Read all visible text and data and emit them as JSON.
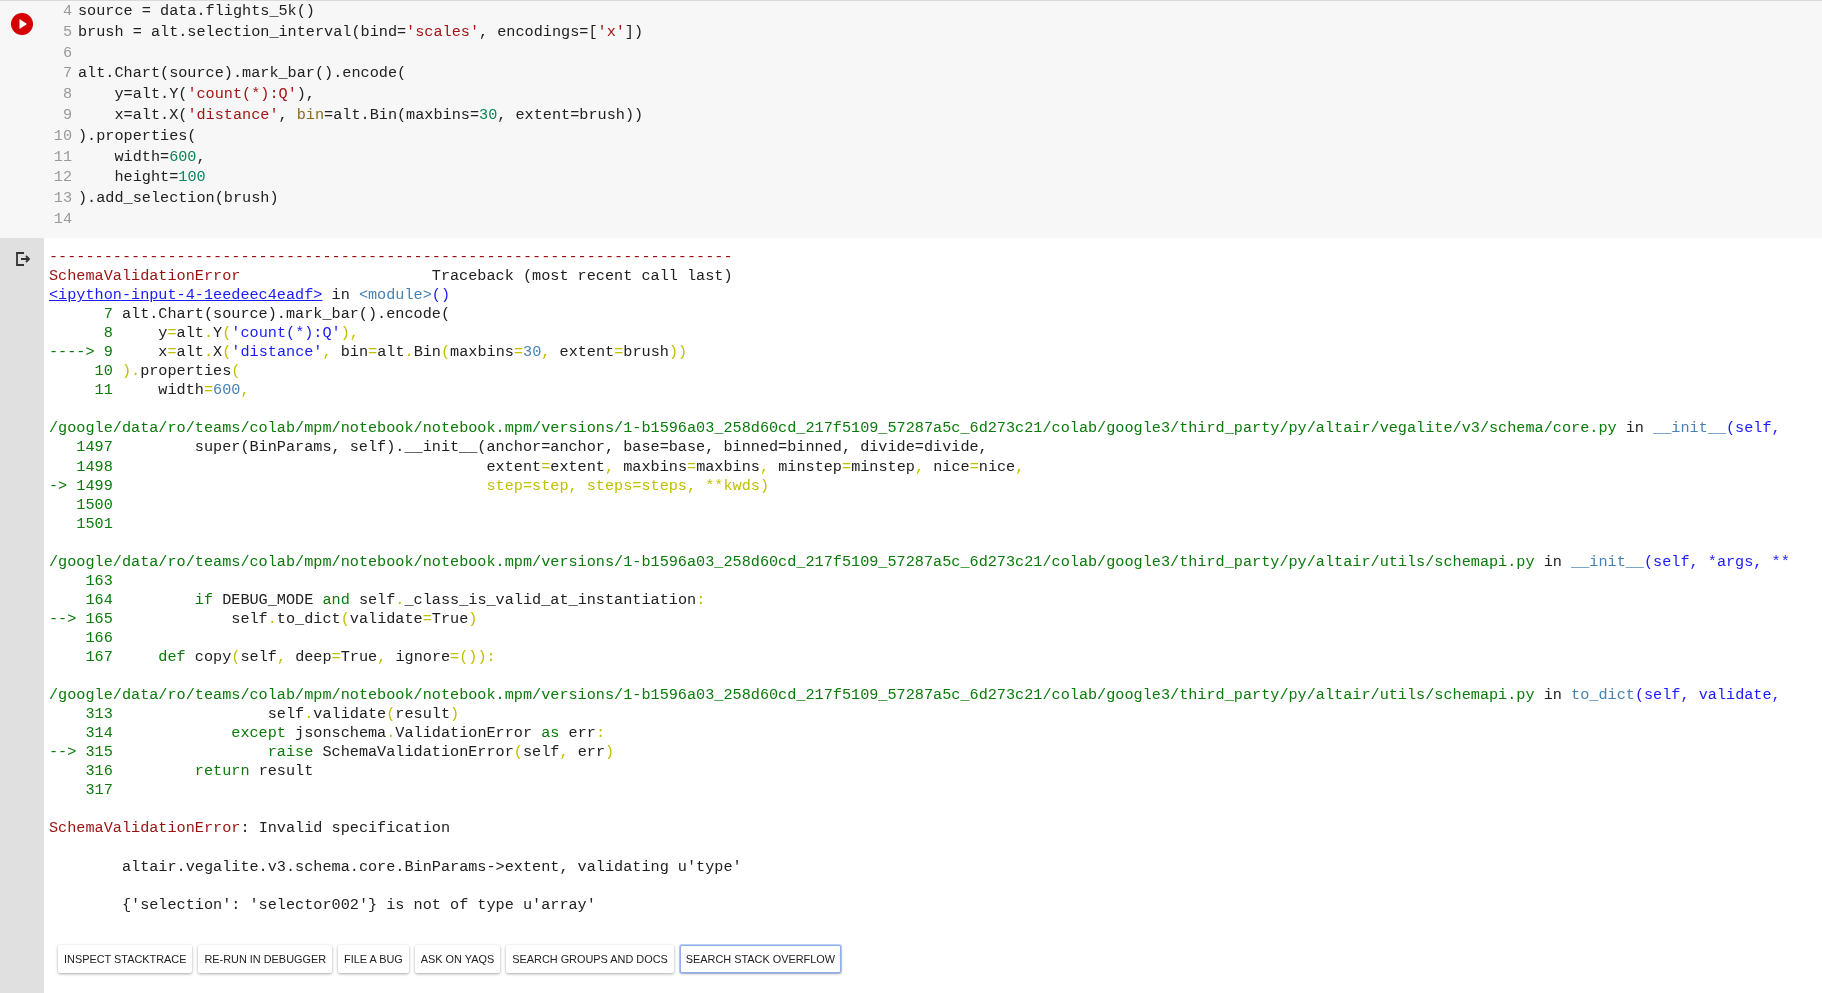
{
  "code_cell": {
    "lines": [
      {
        "number": "4",
        "tokens": [
          {
            "text": "source = data.flights_5k()",
            "kind": "plain"
          }
        ]
      },
      {
        "number": "5",
        "tokens": [
          {
            "text": "brush = alt.selection_interval(bind=",
            "kind": "plain"
          },
          {
            "text": "'scales'",
            "kind": "string"
          },
          {
            "text": ", encodings=[",
            "kind": "plain"
          },
          {
            "text": "'x'",
            "kind": "string"
          },
          {
            "text": "])",
            "kind": "plain"
          }
        ]
      },
      {
        "number": "6"
      },
      {
        "number": "7",
        "tokens": [
          {
            "text": "alt.Chart(source).mark_bar().encode(",
            "kind": "plain"
          }
        ]
      },
      {
        "number": "8",
        "tokens": [
          {
            "text": "    y=alt.Y(",
            "kind": "plain"
          },
          {
            "text": "'count(*):Q'",
            "kind": "string"
          },
          {
            "text": "),",
            "kind": "plain"
          }
        ]
      },
      {
        "number": "9",
        "tokens": [
          {
            "text": "    x=alt.X(",
            "kind": "plain"
          },
          {
            "text": "'distance'",
            "kind": "string"
          },
          {
            "text": ", ",
            "kind": "plain"
          },
          {
            "text": "bin",
            "kind": "param"
          },
          {
            "text": "=alt.Bin(maxbins=",
            "kind": "plain"
          },
          {
            "text": "30",
            "kind": "number"
          },
          {
            "text": ", extent=brush))",
            "kind": "plain"
          }
        ]
      },
      {
        "number": "10",
        "tokens": [
          {
            "text": ").properties(",
            "kind": "plain"
          }
        ]
      },
      {
        "number": "11",
        "tokens": [
          {
            "text": "    width=",
            "kind": "plain"
          },
          {
            "text": "600",
            "kind": "number"
          },
          {
            "text": ",",
            "kind": "plain"
          }
        ]
      },
      {
        "number": "12",
        "tokens": [
          {
            "text": "    height=",
            "kind": "plain"
          },
          {
            "text": "100",
            "kind": "number"
          }
        ]
      },
      {
        "number": "13",
        "tokens": [
          {
            "text": ").add_selection(brush)",
            "kind": "plain"
          }
        ]
      },
      {
        "number": "14"
      }
    ]
  },
  "output": {
    "separator": "---------------------------------------------------------------------------",
    "error_name": "SchemaValidationError",
    "traceback_label": "Traceback (most recent call last)",
    "frames": [
      {
        "location": [
          {
            "text": "<ipython-input-4-1eedeec4eadf>",
            "kind": "link"
          },
          {
            "text": " in ",
            "kind": "plain"
          },
          {
            "text": "<module>",
            "kind": "name"
          },
          {
            "text": "()",
            "kind": "call"
          }
        ],
        "lines": [
          {
            "number": "7",
            "tokens": [
              {
                "text": "alt.Chart(source).mark_bar().encode(",
                "kind": "plain"
              }
            ]
          },
          {
            "number": "8",
            "tokens": [
              {
                "text": "    y",
                "kind": "plain"
              },
              {
                "text": "=",
                "kind": "punct"
              },
              {
                "text": "alt",
                "kind": "plain"
              },
              {
                "text": ".",
                "kind": "punct"
              },
              {
                "text": "Y",
                "kind": "plain"
              },
              {
                "text": "(",
                "kind": "punct"
              },
              {
                "text": "'count(*):Q'",
                "kind": "string"
              },
              {
                "text": "),",
                "kind": "punct"
              }
            ]
          },
          {
            "marker": "---->",
            "number": "9",
            "tokens": [
              {
                "text": "    x",
                "kind": "plain"
              },
              {
                "text": "=",
                "kind": "punct"
              },
              {
                "text": "alt",
                "kind": "plain"
              },
              {
                "text": ".",
                "kind": "punct"
              },
              {
                "text": "X",
                "kind": "plain"
              },
              {
                "text": "(",
                "kind": "punct"
              },
              {
                "text": "'distance'",
                "kind": "string"
              },
              {
                "text": ", ",
                "kind": "punct"
              },
              {
                "text": "bin",
                "kind": "plain"
              },
              {
                "text": "=",
                "kind": "punct"
              },
              {
                "text": "alt",
                "kind": "plain"
              },
              {
                "text": ".",
                "kind": "punct"
              },
              {
                "text": "Bin",
                "kind": "plain"
              },
              {
                "text": "(",
                "kind": "punct"
              },
              {
                "text": "maxbins",
                "kind": "plain"
              },
              {
                "text": "=",
                "kind": "punct"
              },
              {
                "text": "30",
                "kind": "number"
              },
              {
                "text": ", ",
                "kind": "punct"
              },
              {
                "text": "extent",
                "kind": "plain"
              },
              {
                "text": "=",
                "kind": "punct"
              },
              {
                "text": "brush",
                "kind": "plain"
              },
              {
                "text": "))",
                "kind": "punct"
              }
            ]
          },
          {
            "number": "10",
            "tokens": [
              {
                "text": ").",
                "kind": "punct"
              },
              {
                "text": "properties",
                "kind": "plain"
              },
              {
                "text": "(",
                "kind": "punct"
              }
            ]
          },
          {
            "number": "11",
            "tokens": [
              {
                "text": "    width",
                "kind": "plain"
              },
              {
                "text": "=",
                "kind": "punct"
              },
              {
                "text": "600",
                "kind": "number"
              },
              {
                "text": ",",
                "kind": "punct"
              }
            ]
          }
        ]
      },
      {
        "location": [
          {
            "text": "/google/data/ro/teams/colab/mpm/notebook/notebook.mpm/versions/1-b1596a03_258d60cd_217f5109_57287a5c_6d273c21/colab/google3/third_party/py/altair/vegalite/v3/schema/core.py",
            "kind": "path"
          },
          {
            "text": " in ",
            "kind": "plain"
          },
          {
            "text": "__init__",
            "kind": "name"
          },
          {
            "text": "(self,",
            "kind": "call"
          }
        ],
        "lines": [
          {
            "number": "1497",
            "tokens": [
              {
                "text": "        super(BinParams, self).__init__(anchor=anchor, base=base, binned=binned, divide=divide,",
                "kind": "plain"
              }
            ]
          },
          {
            "number": "1498",
            "tokens": [
              {
                "text": "                                        extent",
                "kind": "plain"
              },
              {
                "text": "=",
                "kind": "punct"
              },
              {
                "text": "extent",
                "kind": "plain"
              },
              {
                "text": ", ",
                "kind": "punct"
              },
              {
                "text": "maxbins",
                "kind": "plain"
              },
              {
                "text": "=",
                "kind": "punct"
              },
              {
                "text": "maxbins",
                "kind": "plain"
              },
              {
                "text": ", ",
                "kind": "punct"
              },
              {
                "text": "minstep",
                "kind": "plain"
              },
              {
                "text": "=",
                "kind": "punct"
              },
              {
                "text": "minstep",
                "kind": "plain"
              },
              {
                "text": ", ",
                "kind": "punct"
              },
              {
                "text": "nice",
                "kind": "plain"
              },
              {
                "text": "=",
                "kind": "punct"
              },
              {
                "text": "nice",
                "kind": "plain"
              },
              {
                "text": ",",
                "kind": "punct"
              }
            ]
          },
          {
            "marker": "->",
            "number": "1499",
            "tokens": [
              {
                "text": "                                        step=step, steps=steps, **kwds)",
                "kind": "punct"
              }
            ]
          },
          {
            "number": "1500"
          },
          {
            "number": "1501"
          }
        ]
      },
      {
        "location": [
          {
            "text": "/google/data/ro/teams/colab/mpm/notebook/notebook.mpm/versions/1-b1596a03_258d60cd_217f5109_57287a5c_6d273c21/colab/google3/third_party/py/altair/utils/schemapi.py",
            "kind": "path"
          },
          {
            "text": " in ",
            "kind": "plain"
          },
          {
            "text": "__init__",
            "kind": "name"
          },
          {
            "text": "(self, *args, **",
            "kind": "call"
          }
        ],
        "lines": [
          {
            "number": "163"
          },
          {
            "number": "164",
            "tokens": [
              {
                "text": "        if",
                "kind": "keyword"
              },
              {
                "text": " DEBUG_MODE ",
                "kind": "plain"
              },
              {
                "text": "and",
                "kind": "keyword"
              },
              {
                "text": " self",
                "kind": "plain"
              },
              {
                "text": ".",
                "kind": "punct"
              },
              {
                "text": "_class_is_valid_at_instantiation",
                "kind": "plain"
              },
              {
                "text": ":",
                "kind": "punct"
              }
            ]
          },
          {
            "marker": "-->",
            "number": "165",
            "tokens": [
              {
                "text": "            self",
                "kind": "plain"
              },
              {
                "text": ".",
                "kind": "punct"
              },
              {
                "text": "to_dict",
                "kind": "plain"
              },
              {
                "text": "(",
                "kind": "punct"
              },
              {
                "text": "validate",
                "kind": "plain"
              },
              {
                "text": "=",
                "kind": "punct"
              },
              {
                "text": "True",
                "kind": "plain"
              },
              {
                "text": ")",
                "kind": "punct"
              }
            ]
          },
          {
            "number": "166"
          },
          {
            "number": "167",
            "tokens": [
              {
                "text": "    def",
                "kind": "keyword"
              },
              {
                "text": " copy",
                "kind": "plain"
              },
              {
                "text": "(",
                "kind": "punct"
              },
              {
                "text": "self",
                "kind": "plain"
              },
              {
                "text": ", ",
                "kind": "punct"
              },
              {
                "text": "deep",
                "kind": "plain"
              },
              {
                "text": "=",
                "kind": "punct"
              },
              {
                "text": "True",
                "kind": "plain"
              },
              {
                "text": ", ",
                "kind": "punct"
              },
              {
                "text": "ignore",
                "kind": "plain"
              },
              {
                "text": "=()):",
                "kind": "punct"
              }
            ]
          }
        ]
      },
      {
        "location": [
          {
            "text": "/google/data/ro/teams/colab/mpm/notebook/notebook.mpm/versions/1-b1596a03_258d60cd_217f5109_57287a5c_6d273c21/colab/google3/third_party/py/altair/utils/schemapi.py",
            "kind": "path"
          },
          {
            "text": " in ",
            "kind": "plain"
          },
          {
            "text": "to_dict",
            "kind": "name"
          },
          {
            "text": "(self, validate,",
            "kind": "call"
          }
        ],
        "lines": [
          {
            "number": "313",
            "tokens": [
              {
                "text": "                self",
                "kind": "plain"
              },
              {
                "text": ".",
                "kind": "punct"
              },
              {
                "text": "validate",
                "kind": "plain"
              },
              {
                "text": "(",
                "kind": "punct"
              },
              {
                "text": "result",
                "kind": "plain"
              },
              {
                "text": ")",
                "kind": "punct"
              }
            ]
          },
          {
            "number": "314",
            "tokens": [
              {
                "text": "            except",
                "kind": "keyword"
              },
              {
                "text": " jsonschema",
                "kind": "plain"
              },
              {
                "text": ".",
                "kind": "punct"
              },
              {
                "text": "ValidationError ",
                "kind": "plain"
              },
              {
                "text": "as",
                "kind": "keyword"
              },
              {
                "text": " err",
                "kind": "plain"
              },
              {
                "text": ":",
                "kind": "punct"
              }
            ]
          },
          {
            "marker": "-->",
            "number": "315",
            "tokens": [
              {
                "text": "                raise",
                "kind": "keyword"
              },
              {
                "text": " SchemaValidationError",
                "kind": "plain"
              },
              {
                "text": "(",
                "kind": "punct"
              },
              {
                "text": "self",
                "kind": "plain"
              },
              {
                "text": ", ",
                "kind": "punct"
              },
              {
                "text": "err",
                "kind": "plain"
              },
              {
                "text": ")",
                "kind": "punct"
              }
            ]
          },
          {
            "number": "316",
            "tokens": [
              {
                "text": "        return",
                "kind": "keyword"
              },
              {
                "text": " result",
                "kind": "plain"
              }
            ]
          },
          {
            "number": "317"
          }
        ]
      }
    ],
    "message": [
      {
        "text": "SchemaValidationError",
        "kind": "error"
      },
      {
        "text": ": Invalid specification",
        "kind": "plain"
      }
    ],
    "details": [
      "        altair.vegalite.v3.schema.core.BinParams->extent, validating u'type'",
      "        {'selection': 'selector002'} is not of type u'array'"
    ],
    "buttons": [
      {
        "label": "INSPECT STACKTRACE",
        "focused": false
      },
      {
        "label": "RE-RUN IN DEBUGGER",
        "focused": false
      },
      {
        "label": "FILE A BUG",
        "focused": false
      },
      {
        "label": "ASK ON YAQS",
        "focused": false
      },
      {
        "label": "SEARCH GROUPS AND DOCS",
        "focused": false
      },
      {
        "label": "SEARCH STACK OVERFLOW",
        "focused": true
      }
    ]
  }
}
